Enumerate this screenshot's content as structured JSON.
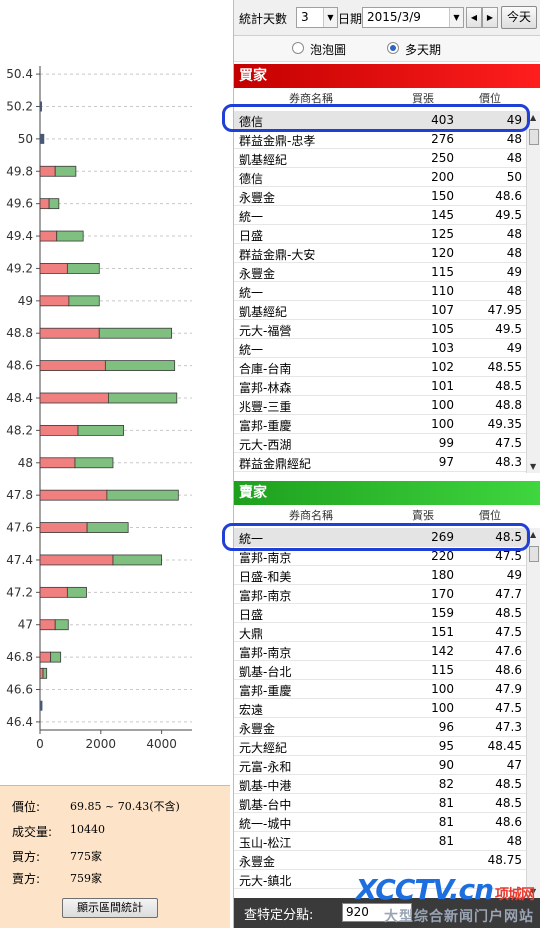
{
  "toolbar": {
    "days_label": "統計天數",
    "days_value": "3",
    "date_label": "日期",
    "date_value": "2015/3/9",
    "today_label": "今天"
  },
  "modes": {
    "bubble_label": "泡泡圖",
    "multiday_label": "多天期",
    "selected": "multiday"
  },
  "buy": {
    "title": "買家",
    "col_broker": "券商名稱",
    "col_qty": "買張",
    "col_price": "價位",
    "rows": [
      {
        "name": "德信",
        "qty": "403",
        "price": "49"
      },
      {
        "name": "群益金鼎-忠孝",
        "qty": "276",
        "price": "48"
      },
      {
        "name": "凱基經紀",
        "qty": "250",
        "price": "48"
      },
      {
        "name": "德信",
        "qty": "200",
        "price": "50"
      },
      {
        "name": "永豐金",
        "qty": "150",
        "price": "48.6"
      },
      {
        "name": "統一",
        "qty": "145",
        "price": "49.5"
      },
      {
        "name": "日盛",
        "qty": "125",
        "price": "48"
      },
      {
        "name": "群益金鼎-大安",
        "qty": "120",
        "price": "48"
      },
      {
        "name": "永豐金",
        "qty": "115",
        "price": "49"
      },
      {
        "name": "統一",
        "qty": "110",
        "price": "48"
      },
      {
        "name": "凱基經紀",
        "qty": "107",
        "price": "47.95"
      },
      {
        "name": "元大-福營",
        "qty": "105",
        "price": "49.5"
      },
      {
        "name": "統一",
        "qty": "103",
        "price": "49"
      },
      {
        "name": "合庫-台南",
        "qty": "102",
        "price": "48.55"
      },
      {
        "name": "富邦-林森",
        "qty": "101",
        "price": "48.5"
      },
      {
        "name": "兆豐-三重",
        "qty": "100",
        "price": "48.8"
      },
      {
        "name": "富邦-重慶",
        "qty": "100",
        "price": "49.35"
      },
      {
        "name": "元大-西湖",
        "qty": "99",
        "price": "47.5"
      },
      {
        "name": "群益金鼎經紀",
        "qty": "97",
        "price": "48.3"
      }
    ]
  },
  "sell": {
    "title": "賣家",
    "col_broker": "券商名稱",
    "col_qty": "賣張",
    "col_price": "價位",
    "rows": [
      {
        "name": "統一",
        "qty": "269",
        "price": "48.5"
      },
      {
        "name": "富邦-南京",
        "qty": "220",
        "price": "47.5"
      },
      {
        "name": "日盛-和美",
        "qty": "180",
        "price": "49"
      },
      {
        "name": "富邦-南京",
        "qty": "170",
        "price": "47.7"
      },
      {
        "name": "日盛",
        "qty": "159",
        "price": "48.5"
      },
      {
        "name": "大鼎",
        "qty": "151",
        "price": "47.5"
      },
      {
        "name": "富邦-南京",
        "qty": "142",
        "price": "47.6"
      },
      {
        "name": "凱基-台北",
        "qty": "115",
        "price": "48.6"
      },
      {
        "name": "富邦-重慶",
        "qty": "100",
        "price": "47.9"
      },
      {
        "name": "宏遠",
        "qty": "100",
        "price": "47.5"
      },
      {
        "name": "永豐金",
        "qty": "96",
        "price": "47.3"
      },
      {
        "name": "元大經紀",
        "qty": "95",
        "price": "48.45"
      },
      {
        "name": "元富-永和",
        "qty": "90",
        "price": "47"
      },
      {
        "name": "凱基-中港",
        "qty": "82",
        "price": "48.5"
      },
      {
        "name": "凱基-台中",
        "qty": "81",
        "price": "48.5"
      },
      {
        "name": "統一-城中",
        "qty": "81",
        "price": "48.6"
      },
      {
        "name": "玉山-松江",
        "qty": "81",
        "price": "48"
      },
      {
        "name": "永豐金",
        "qty": "",
        "price": "48.75"
      },
      {
        "name": "元大-鎮北",
        "qty": "",
        "price": ""
      }
    ]
  },
  "summary": {
    "price_label": "價位:",
    "price_value": "69.85 ~ 70.43(不含)",
    "volume_label": "成交量:",
    "volume_value": "10440",
    "buyers_label": "買方:",
    "buyers_value": "775家",
    "sellers_label": "賣方:",
    "sellers_value": "759家",
    "button_label": "顯示區間統計"
  },
  "bottom": {
    "point_label": "查特定分點:",
    "point_value": "920"
  },
  "watermark": {
    "brand": "XCCTV",
    "brand_suffix": ".cn",
    "cn_name": "项城网",
    "slogan": "大型综合新闻门户网站"
  },
  "chart_data": {
    "type": "bar",
    "orientation": "horizontal-stacked",
    "y_ticks": [
      "50.4",
      "50.2",
      "50",
      "49.8",
      "49.6",
      "49.4",
      "49.2",
      "49",
      "48.8",
      "48.6",
      "48.4",
      "48.2",
      "48",
      "47.8",
      "47.6",
      "47.4",
      "47.2",
      "47",
      "46.8",
      "46.6",
      "46.4"
    ],
    "x_ticks": [
      "0",
      "2000",
      "4000"
    ],
    "xlim": [
      0,
      5000
    ],
    "ylim": [
      46.35,
      50.45
    ],
    "grid": true,
    "colors": {
      "buy": "#f08080",
      "sell": "#7fbf7f",
      "neutral": "#4a5878"
    },
    "series": [
      {
        "name": "buy",
        "values": [
          [
            50.2,
            40
          ],
          [
            50.0,
            60
          ],
          [
            49.8,
            500
          ],
          [
            49.6,
            300
          ],
          [
            49.4,
            550
          ],
          [
            49.2,
            900
          ],
          [
            49.0,
            950
          ],
          [
            48.8,
            1950
          ],
          [
            48.6,
            2150
          ],
          [
            48.4,
            2250
          ],
          [
            48.2,
            1250
          ],
          [
            48.0,
            1150
          ],
          [
            47.8,
            2200
          ],
          [
            47.6,
            1550
          ],
          [
            47.4,
            2400
          ],
          [
            47.2,
            900
          ],
          [
            47.0,
            500
          ],
          [
            46.8,
            350
          ],
          [
            46.7,
            100
          ],
          [
            46.5,
            20
          ]
        ]
      },
      {
        "name": "sell",
        "values": [
          [
            50.2,
            20
          ],
          [
            50.0,
            80
          ],
          [
            49.8,
            680
          ],
          [
            49.6,
            320
          ],
          [
            49.4,
            870
          ],
          [
            49.2,
            1050
          ],
          [
            49.0,
            1000
          ],
          [
            48.8,
            2380
          ],
          [
            48.6,
            2280
          ],
          [
            48.4,
            2250
          ],
          [
            48.2,
            1500
          ],
          [
            48.0,
            1250
          ],
          [
            47.8,
            2350
          ],
          [
            47.6,
            1350
          ],
          [
            47.4,
            1600
          ],
          [
            47.2,
            630
          ],
          [
            47.0,
            430
          ],
          [
            46.8,
            330
          ],
          [
            46.7,
            120
          ],
          [
            46.5,
            60
          ]
        ]
      }
    ]
  }
}
